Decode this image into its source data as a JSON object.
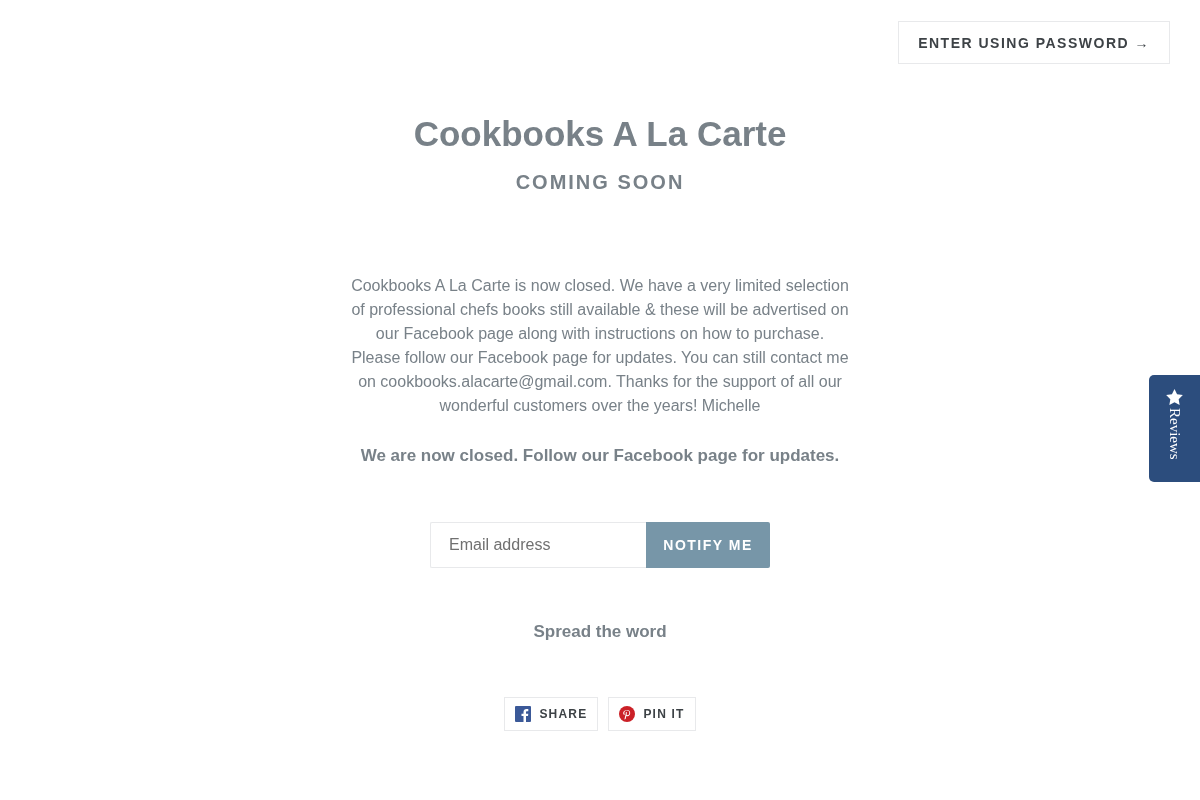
{
  "header": {
    "password_button": "ENTER USING PASSWORD →"
  },
  "store": {
    "title": "Cookbooks A La Carte",
    "subtitle": "COMING SOON"
  },
  "message": "Cookbooks A La Carte is now closed. We have a very limited selection of professional chefs books still available & these will be advertised on our Facebook page along with instructions on how to purchase. Please follow our Facebook page for updates. You can still contact me on cookbooks.alacarte@gmail.com. Thanks for the support of all our wonderful customers over the years! Michelle",
  "notice": "We are now closed. Follow our Facebook page for updates.",
  "signup": {
    "placeholder": "Email address",
    "button": "NOTIFY ME"
  },
  "share": {
    "heading": "Spread the word",
    "buttons": [
      {
        "kind": "facebook",
        "label": "SHARE"
      },
      {
        "kind": "pinterest",
        "label": "PIN IT"
      }
    ]
  },
  "reviews_tab": {
    "label": "Reviews"
  }
}
